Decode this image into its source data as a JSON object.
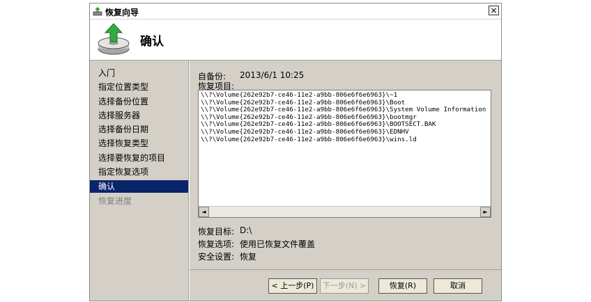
{
  "window": {
    "title": "恢复向导",
    "close_glyph": "×"
  },
  "header": {
    "title": "确认",
    "icon": "restore-disk-icon"
  },
  "sidebar": {
    "items": [
      {
        "label": "入门",
        "state": "normal"
      },
      {
        "label": "指定位置类型",
        "state": "normal"
      },
      {
        "label": "选择备份位置",
        "state": "normal"
      },
      {
        "label": "选择服务器",
        "state": "normal"
      },
      {
        "label": "选择备份日期",
        "state": "normal"
      },
      {
        "label": "选择恢复类型",
        "state": "normal"
      },
      {
        "label": "选择要恢复的项目",
        "state": "normal"
      },
      {
        "label": "指定恢复选项",
        "state": "normal"
      },
      {
        "label": "确认",
        "state": "active"
      },
      {
        "label": "恢复进度",
        "state": "disabled"
      }
    ]
  },
  "main": {
    "backup_label": "自备份:",
    "backup_value": "2013/6/1 10:25",
    "items_label": "恢复项目:",
    "items": [
      "\\\\?\\Volume{262e92b7-ce46-11e2-a9bb-806e6f6e6963}\\~1",
      "\\\\?\\Volume{262e92b7-ce46-11e2-a9bb-806e6f6e6963}\\Boot",
      "\\\\?\\Volume{262e92b7-ce46-11e2-a9bb-806e6f6e6963}\\System Volume Information",
      "\\\\?\\Volume{262e92b7-ce46-11e2-a9bb-806e6f6e6963}\\bootmgr",
      "\\\\?\\Volume{262e92b7-ce46-11e2-a9bb-806e6f6e6963}\\BOOTSECT.BAK",
      "\\\\?\\Volume{262e92b7-ce46-11e2-a9bb-806e6f6e6963}\\EDNHV",
      "\\\\?\\Volume{262e92b7-ce46-11e2-a9bb-806e6f6e6963}\\wins.ld"
    ],
    "scroll_left": "◄",
    "scroll_right": "►",
    "target_label": "恢复目标:",
    "target_value": "D:\\",
    "option_label": "恢复选项:",
    "option_value": "使用已恢复文件覆盖",
    "security_label": "安全设置:",
    "security_value": "恢复"
  },
  "buttons": {
    "back": "< 上一步(P)",
    "next": "下一步(N) >",
    "restore": "恢复(R)",
    "cancel": "取消"
  }
}
